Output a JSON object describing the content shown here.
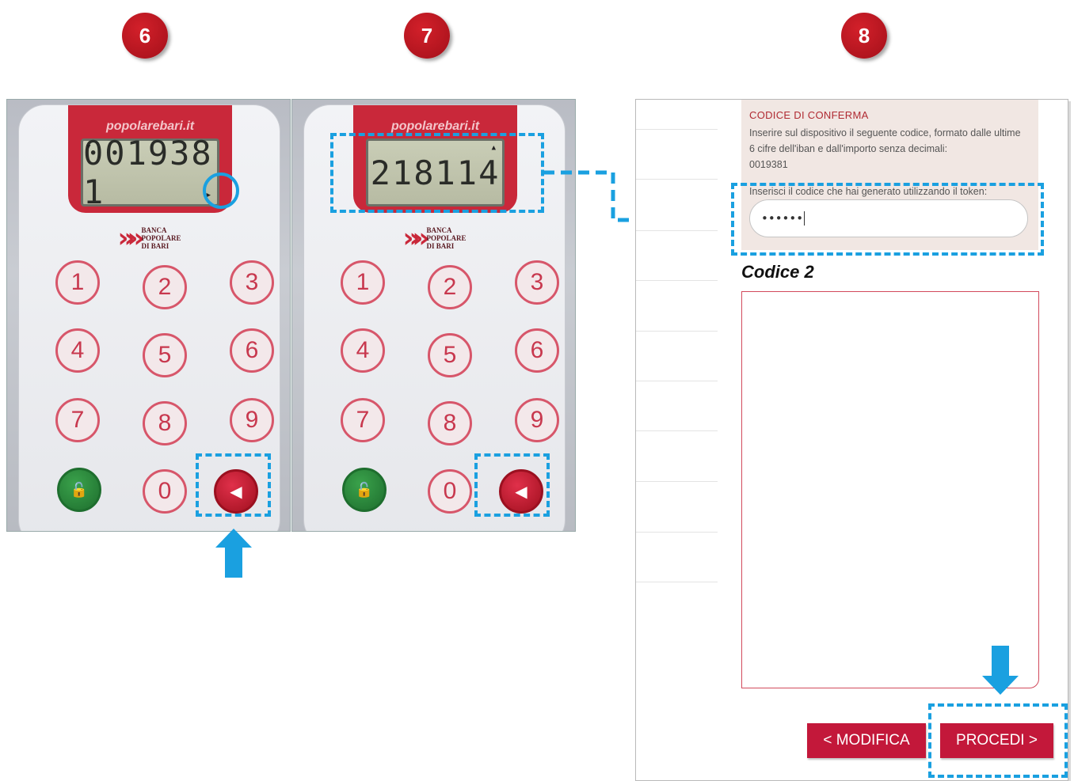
{
  "steps": [
    "6",
    "7",
    "8"
  ],
  "token": {
    "brand": "popolarebari.it",
    "bank_name": [
      "BANCA",
      "POPOLARE",
      "DI BARI"
    ],
    "display_step6": "001938 1",
    "display_step7": "218114",
    "keys": [
      "1",
      "2",
      "3",
      "4",
      "5",
      "6",
      "7",
      "8",
      "9",
      "0"
    ],
    "arrow_key": "◀",
    "lock_key": "🔓"
  },
  "form": {
    "section_title": "CODICE DI CONFERMA",
    "instructions": "Inserire sul dispositivo il seguente codice, formato dalle ultime 6 cifre dell'iban e dall'importo senza decimali:",
    "reference_code": "0019381",
    "input_label": "Inserisci il codice che hai generato utilizzando il token:",
    "input_value": "••••••",
    "codice2_label": "Codice 2",
    "modifica_label": "< MODIFICA",
    "procedi_label": "PROCEDI >"
  },
  "colors": {
    "step_badge": "#b3141e",
    "highlight": "#1aa0e0",
    "button": "#c3183a",
    "token_red": "#c9283a"
  }
}
